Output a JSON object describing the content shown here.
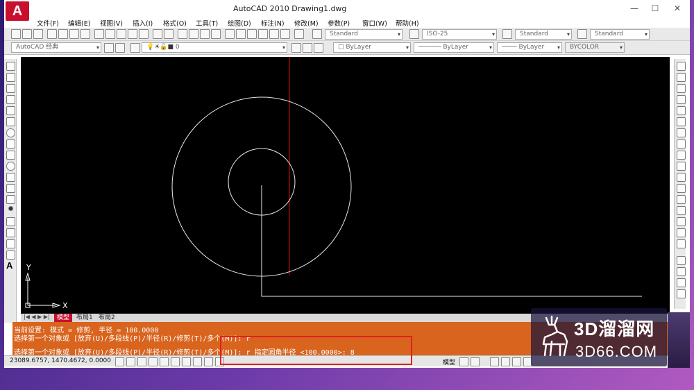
{
  "window": {
    "logo": "A",
    "title": "AutoCAD 2010     Drawing1.dwg",
    "controls": [
      "—",
      "☐",
      "✕"
    ]
  },
  "menu": [
    "文件(F)",
    "编辑(E)",
    "视图(V)",
    "插入(I)",
    "格式(O)",
    "工具(T)",
    "绘图(D)",
    "标注(N)",
    "修改(M)",
    "参数(P)",
    "窗口(W)",
    "帮助(H)"
  ],
  "toolbar": {
    "text_style": "Standard",
    "dim_style": "ISO-25",
    "table_style": "Standard",
    "multileader_style": "Standard"
  },
  "toolbar2": {
    "workspace": "AutoCAD 经典",
    "layer": "0",
    "color": "ByLayer",
    "linetype": "ByLayer",
    "lineweight": "ByLayer",
    "plotstyle": "BYCOLOR"
  },
  "ucs": {
    "y": "Y",
    "x": "X"
  },
  "tabs": [
    "模型",
    "布局1",
    "布局2"
  ],
  "command": {
    "line1": "当前设置: 模式 = 修剪, 半径 = 100.0000",
    "line2": "选择第一个对象或 [放弃(U)/多段线(P)/半径(R)/修剪(T)/多个(M)]: r",
    "line3": "选择第一个对象或 [放弃(U)/多段线(P)/半径(R)/修剪(T)/多个(M)]: r 指定圆角半径 <100.0000>: 8"
  },
  "status": {
    "coords": "23089.6757, 1470.4672, 0.0000",
    "model_label": "模型"
  },
  "watermark": {
    "brand": "3D溜溜网",
    "url": "3D66.COM"
  },
  "colors": {
    "command_bg": "#d9641e",
    "highlight": "#e02020",
    "canvas": "#000000"
  }
}
